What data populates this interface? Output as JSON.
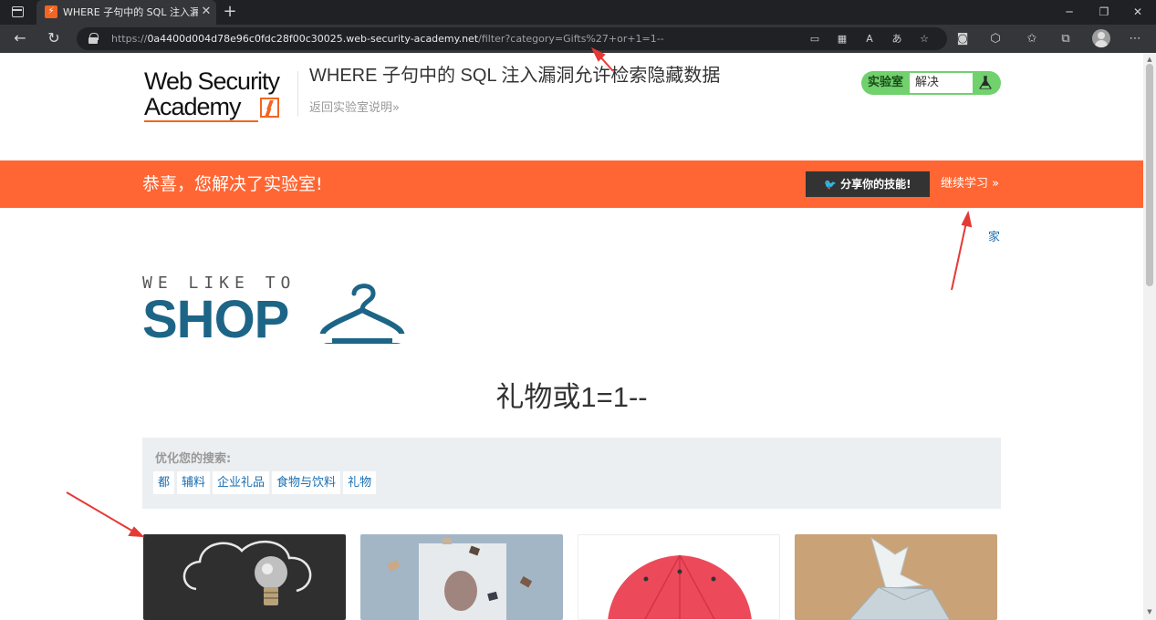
{
  "browser": {
    "tab_title": "WHERE 子句中的 SQL 注入漏洞允许检索隐藏数据",
    "tab_favicon": "⚡",
    "url_scheme": "https://",
    "url_host": "0a4400d004d78e96c0fdc28f00c30025.web-security-academy.net",
    "url_path": "/filter?category=Gifts%27+or+1=1--"
  },
  "header": {
    "logo_line1": "Web Security",
    "logo_line2": "Academy",
    "lab_title": "WHERE 子句中的 SQL 注入漏洞允许检索隐藏数据",
    "back_link": "返回实验室说明»",
    "lab_status_label": "实验室",
    "lab_status_value": "解决"
  },
  "banner": {
    "message": "恭喜，您解决了实验室!",
    "share_label": "分享你的技能!",
    "continue_label": "继续学习 »"
  },
  "nav": {
    "home": "家"
  },
  "shop_logo": {
    "tagline": "WE LIKE TO",
    "word": "SHOP"
  },
  "main": {
    "heading": "礼物或1=1--"
  },
  "filter": {
    "label": "优化您的搜索:",
    "categories": [
      "都",
      "辅料",
      "企业礼品",
      "食物与饮料",
      "礼物"
    ]
  },
  "colors": {
    "banner": "#ff6633",
    "lab_status": "#70d16d",
    "link": "#1a6fb3",
    "shop_blue": "#1d6587",
    "annotation": "#e53935"
  }
}
